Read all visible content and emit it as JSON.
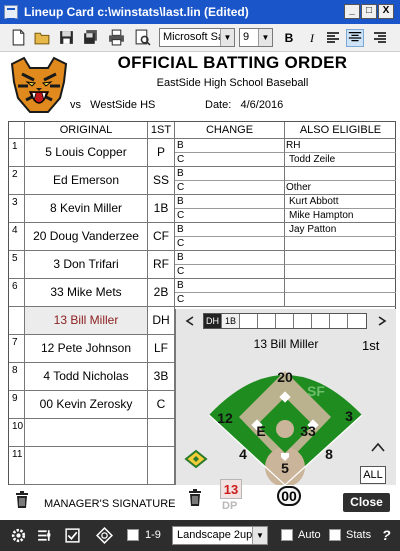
{
  "window": {
    "title": "Lineup Card c:\\winstats\\last.lin (Edited)",
    "minimize": "_",
    "maximize": "□",
    "close": "X"
  },
  "toolbar": {
    "font_name": "Microsoft Sa",
    "font_size": "9",
    "bold": "B",
    "italic": "I"
  },
  "header": {
    "heading": "OFFICIAL BATTING ORDER",
    "school": "EastSide High School Baseball",
    "vs_label": "vs",
    "opponent": "WestSide HS",
    "date_label": "Date:",
    "date": "4/6/2016"
  },
  "columns": {
    "original": "ORIGINAL",
    "first": "1ST",
    "change": "CHANGE",
    "also_eligible": "ALSO ELIGIBLE"
  },
  "lineup": [
    {
      "num": "1",
      "player": "5 Louis Copper",
      "pos": "P",
      "changes": [
        "B",
        "C"
      ],
      "eligible": [
        "RH",
        "Todd Zeile"
      ]
    },
    {
      "num": "2",
      "player": "Ed Emerson",
      "pos": "SS",
      "changes": [
        "B",
        "C"
      ],
      "eligible": [
        "",
        "Other"
      ]
    },
    {
      "num": "3",
      "player": "8 Kevin Miller",
      "pos": "1B",
      "changes": [
        "B",
        "C"
      ],
      "eligible": [
        "Kurt Abbott",
        "Mike Hampton"
      ]
    },
    {
      "num": "4",
      "player": "20 Doug Vanderzee",
      "pos": "CF",
      "changes": [
        "B",
        "C"
      ],
      "eligible": [
        "Jay Patton",
        ""
      ]
    },
    {
      "num": "5",
      "player": "3 Don Trifari",
      "pos": "RF",
      "changes": [
        "B",
        "C"
      ],
      "eligible": [
        "",
        ""
      ]
    },
    {
      "num": "6",
      "player": "33 Mike Mets",
      "pos": "2B",
      "changes": [
        "B",
        "C"
      ],
      "eligible": [
        "",
        ""
      ]
    },
    {
      "num": "",
      "player": "13 Bill Miller",
      "pos": "DH",
      "changes": [],
      "eligible": []
    },
    {
      "num": "7",
      "player": "12 Pete Johnson",
      "pos": "LF",
      "changes": [],
      "eligible": []
    },
    {
      "num": "8",
      "player": "4 Todd Nicholas",
      "pos": "3B",
      "changes": [],
      "eligible": []
    },
    {
      "num": "9",
      "player": "00 Kevin Zerosky",
      "pos": "C",
      "changes": [],
      "eligible": []
    },
    {
      "num": "10",
      "player": "",
      "pos": "",
      "changes": [],
      "eligible": []
    },
    {
      "num": "11",
      "player": "",
      "pos": "",
      "changes": [],
      "eligible": []
    }
  ],
  "field": {
    "slots": [
      "DH",
      "1B",
      "",
      "",
      "",
      "",
      "",
      "",
      ""
    ],
    "prev": "<",
    "next": ">",
    "player": "13 Bill Miller",
    "inning": "1st",
    "positions": {
      "cf": "20",
      "sf": "SF",
      "lf": "12",
      "rf": "3",
      "e": "E",
      "ss": "33",
      "tb": "4",
      "p": "5",
      "fb": "8",
      "c": "00"
    },
    "all_label": "ALL",
    "dp_number": "13",
    "dp_label": "DP",
    "colors": {
      "grass": "#1f8c1f",
      "dirt": "#cbb59a",
      "base": "#ffffff"
    }
  },
  "footer": {
    "signature": "MANAGER'S SIGNATURE",
    "close": "Close"
  },
  "statusbar": {
    "range": "1-9",
    "layout": "Landscape 2up",
    "auto": "Auto",
    "stats": "Stats",
    "help": "?"
  }
}
